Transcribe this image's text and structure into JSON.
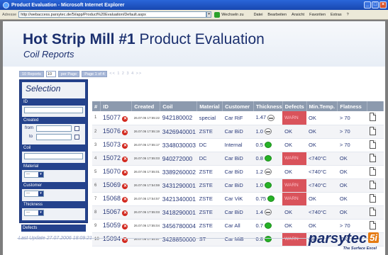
{
  "window": {
    "title": "Product Evaluation - Microsoft Internet Explorer"
  },
  "addressbar": {
    "label": "Adresse",
    "url": "http://webaccess.parsytec.de/5i/app/Product%20Evaluation/Default.aspx",
    "go_label": "Wechseln zu",
    "menus": [
      "Datei",
      "Bearbeiten",
      "Ansicht",
      "Favoriten",
      "Extras",
      "?"
    ]
  },
  "header": {
    "title_bold": "Hot Strip Mill #1",
    "title_rest": " Product Evaluation",
    "subtitle": "Coil Reports"
  },
  "toolbar": {
    "reports_btn": "10 Reports",
    "per_page_value": "10",
    "per_page_btn": "per Page",
    "page_btn": "Page 1 of 4",
    "pager": "<< 1 2 3 4 >>"
  },
  "selection": {
    "title": "Selection",
    "labels": {
      "id": "ID",
      "created": "Created",
      "from": "from",
      "to": "to",
      "coil": "Coil",
      "material": "Material",
      "customer": "Customer",
      "thickness": "Thickness",
      "defects": "Defects"
    },
    "select_placeholder": "---"
  },
  "table": {
    "columns": [
      "#",
      "ID",
      "Created",
      "Coil",
      "Material",
      "Customer",
      "Thickness",
      "Defects",
      "Min.Temp.",
      "Flatness"
    ],
    "rows": [
      {
        "n": "1",
        "id": "15077",
        "created": "26.07.06 17:55:22",
        "coil": "942180002",
        "material": "special",
        "customer": "Car RiF",
        "thickness": "1.47",
        "thick_ok": false,
        "defects": "WARN",
        "defects_warn": true,
        "mintemp": "OK",
        "flatness": "> 70"
      },
      {
        "n": "2",
        "id": "15076",
        "created": "26.07.06 17:55:19",
        "coil": "3426940001",
        "material": "ZSTE",
        "customer": "Car BiD",
        "thickness": "1.0",
        "thick_ok": false,
        "defects": "OK",
        "defects_warn": false,
        "mintemp": "OK",
        "flatness": "> 70"
      },
      {
        "n": "3",
        "id": "15073",
        "created": "26.07.06 17:55:17",
        "coil": "3348030003",
        "material": "DC",
        "customer": "Internal",
        "thickness": "0.5",
        "thick_ok": true,
        "defects": "OK",
        "defects_warn": false,
        "mintemp": "OK",
        "flatness": "> 70"
      },
      {
        "n": "4",
        "id": "15072",
        "created": "26.07.06 17:55:03",
        "coil": "940272000",
        "material": "DC",
        "customer": "Car BiD",
        "thickness": "0.8",
        "thick_ok": true,
        "defects": "WARN",
        "defects_warn": true,
        "mintemp": "<740°C",
        "flatness": "OK"
      },
      {
        "n": "5",
        "id": "15070",
        "created": "26.07.06 17:55:01",
        "coil": "3389260002",
        "material": "ZSTE",
        "customer": "Car BiD",
        "thickness": "1.2",
        "thick_ok": false,
        "defects": "OK",
        "defects_warn": false,
        "mintemp": "<740°C",
        "flatness": "OK"
      },
      {
        "n": "6",
        "id": "15069",
        "created": "26.07.06 17:54:59",
        "coil": "3431290001",
        "material": "ZSTE",
        "customer": "Car BiD",
        "thickness": "1.0",
        "thick_ok": true,
        "defects": "WARN",
        "defects_warn": true,
        "mintemp": "<740°C",
        "flatness": "OK"
      },
      {
        "n": "7",
        "id": "15068",
        "created": "26.07.06 17:54:57",
        "coil": "3421340001",
        "material": "ZSTE",
        "customer": "Car ViK",
        "thickness": "0.75",
        "thick_ok": true,
        "defects": "WARN",
        "defects_warn": true,
        "mintemp": "OK",
        "flatness": "OK"
      },
      {
        "n": "8",
        "id": "15067",
        "created": "26.07.06 17:55:03",
        "coil": "3418290001",
        "material": "ZSTE",
        "customer": "Car BiD",
        "thickness": "1.4",
        "thick_ok": false,
        "defects": "OK",
        "defects_warn": false,
        "mintemp": "<740°C",
        "flatness": "OK"
      },
      {
        "n": "9",
        "id": "15059",
        "created": "26.07.06 17:55:04",
        "coil": "3456780004",
        "material": "ZSTE",
        "customer": "Car All",
        "thickness": "0.7",
        "thick_ok": true,
        "defects": "OK",
        "defects_warn": false,
        "mintemp": "OK",
        "flatness": "> 70"
      },
      {
        "n": "10",
        "id": "15094",
        "created": "26.07.06 17:54:57",
        "coil": "3428850000",
        "material": "ST",
        "customer": "Car MiB",
        "thickness": "0.8",
        "thick_ok": true,
        "defects": "WARN",
        "defects_warn": true,
        "mintemp": "OK",
        "flatness": "OK"
      }
    ]
  },
  "footer": {
    "last_update": "Last Update 27.07.2006 18:09:21",
    "logo_text": "parsytec",
    "logo_badge": "5i",
    "logo_tagline": "The Surface Excel"
  },
  "colors": {
    "navy": "#1b2f6e",
    "header_gray": "#8c9aae",
    "warn_red": "#d9535b",
    "ok_green": "#27b227",
    "accent_orange": "#e57b12"
  }
}
